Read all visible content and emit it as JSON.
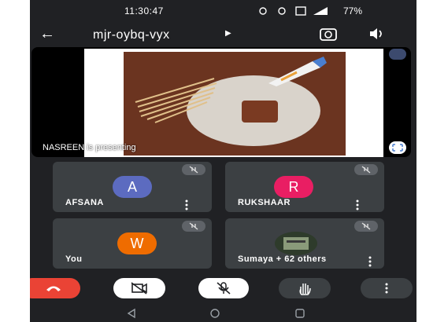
{
  "status": {
    "time": "11:30:47",
    "battery": "77%"
  },
  "header": {
    "meeting_code": "mjr-oybq-vyx"
  },
  "presentation": {
    "label": "NASREEN is presenting"
  },
  "participants": [
    {
      "name": "AFSANA",
      "initial": "A",
      "color": "#5c6bc0"
    },
    {
      "name": "RUKSHAAR",
      "initial": "R",
      "color": "#e91e63"
    },
    {
      "name": "You",
      "initial": "W",
      "color": "#ef6c00"
    },
    {
      "name": "Sumaya + 62 others",
      "initial": "",
      "color": "#2e3b2b"
    }
  ],
  "icons": {
    "back": "arrow-left-icon",
    "camera_switch": "camera-switch-icon",
    "speaker": "speaker-icon",
    "end_call": "end-call-icon",
    "camera_off": "camera-off-icon",
    "mic_off": "mic-off-icon",
    "raise_hand": "raise-hand-icon",
    "more": "more-vert-icon"
  },
  "colors": {
    "end_call": "#ea4335",
    "background": "#202124",
    "tile": "#3c4043"
  }
}
